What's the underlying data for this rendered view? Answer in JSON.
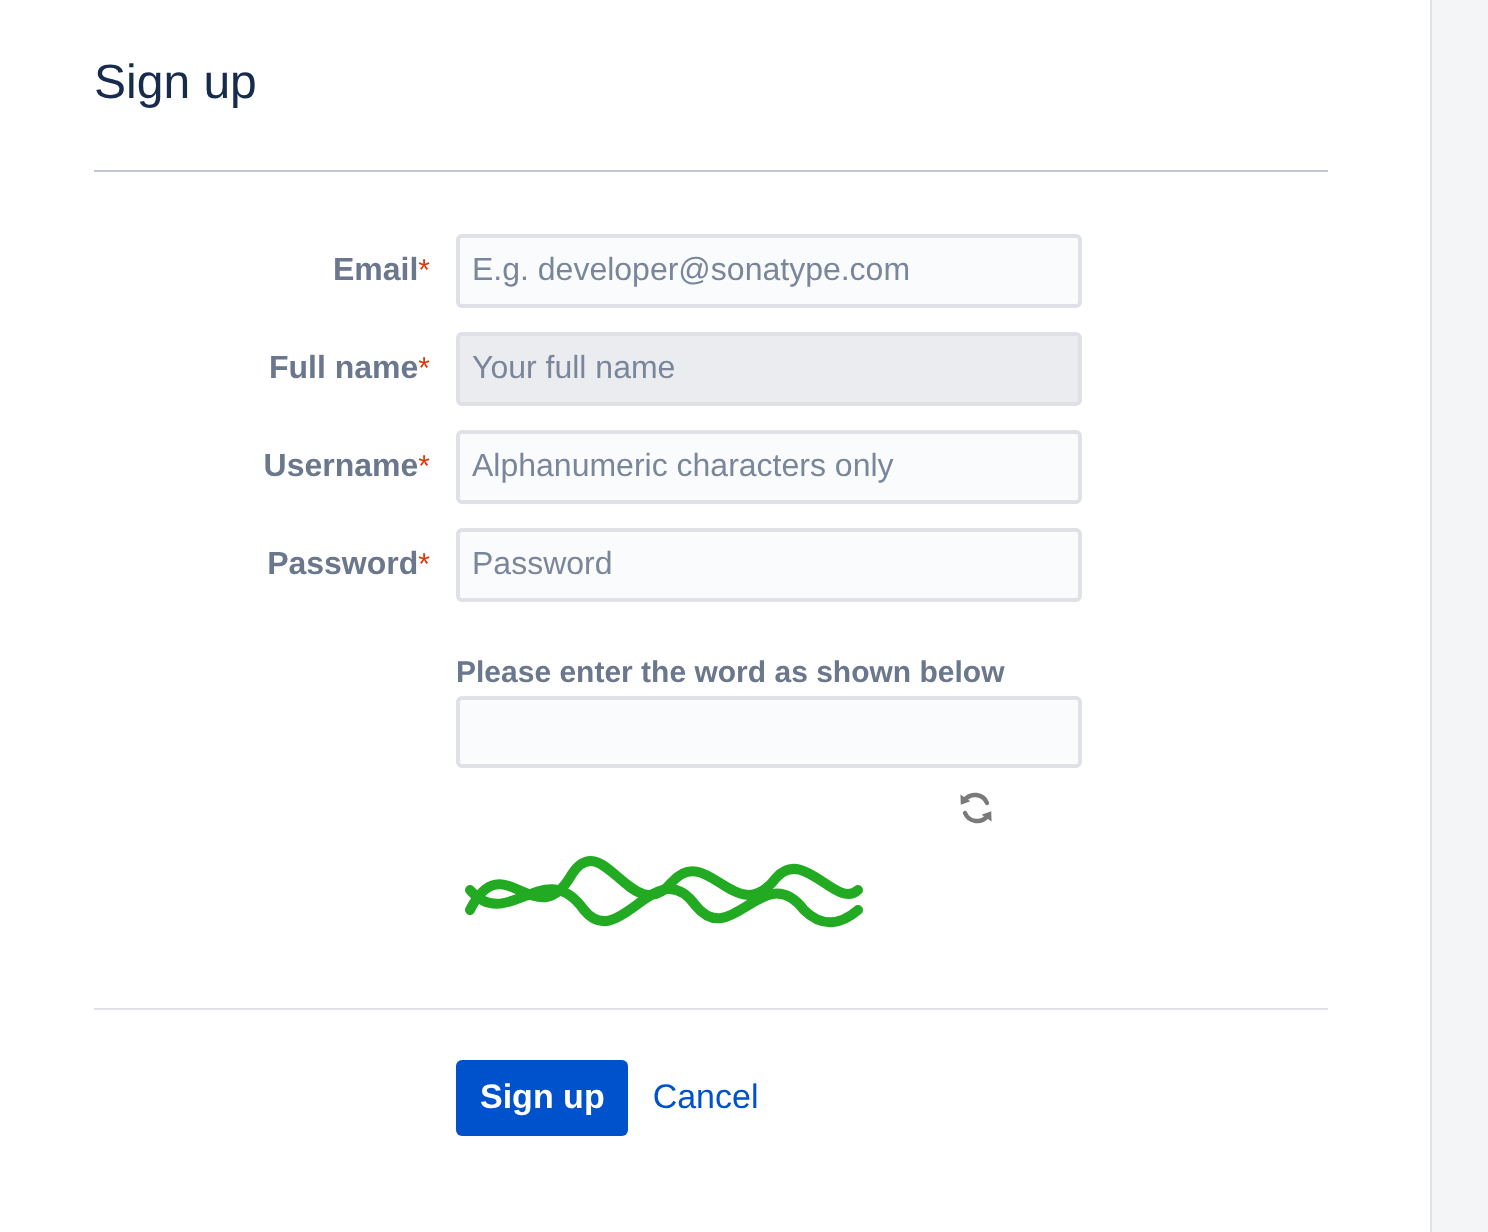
{
  "title": "Sign up",
  "fields": [
    {
      "label": "Email",
      "required_mark": "*",
      "placeholder": "E.g. developer@sonatype.com",
      "hovered": false
    },
    {
      "label": "Full name",
      "required_mark": "*",
      "placeholder": "Your full name",
      "hovered": true
    },
    {
      "label": "Username",
      "required_mark": "*",
      "placeholder": "Alphanumeric characters only",
      "hovered": false
    },
    {
      "label": "Password",
      "required_mark": "*",
      "placeholder": "Password",
      "hovered": false
    }
  ],
  "captcha": {
    "label": "Please enter the word as shown below"
  },
  "actions": {
    "submit": "Sign up",
    "cancel": "Cancel"
  }
}
